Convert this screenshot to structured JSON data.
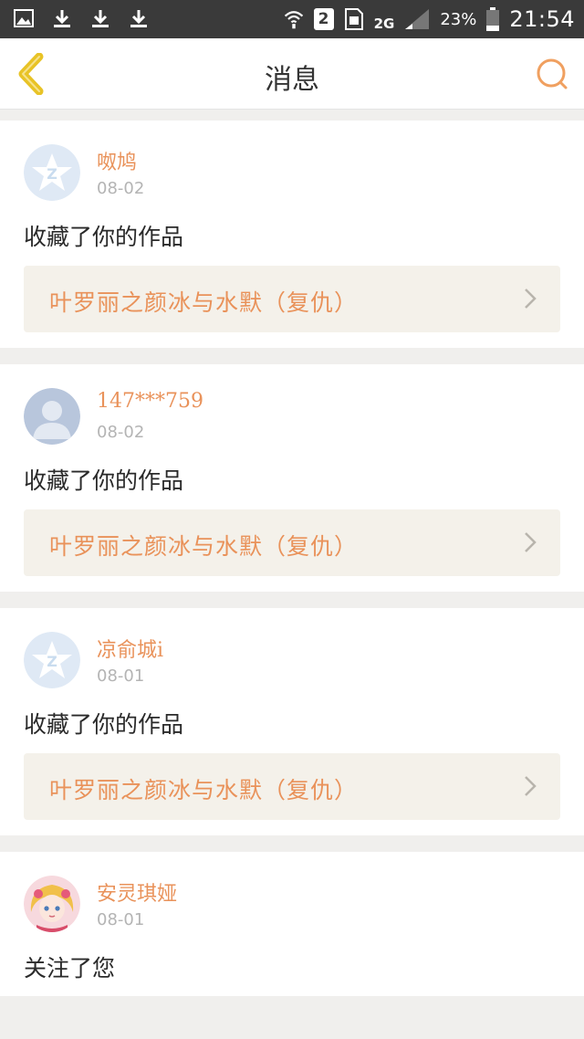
{
  "status_bar": {
    "signal_type": "2G",
    "battery": "23%",
    "time": "21:54",
    "sim": "2"
  },
  "header": {
    "title": "消息"
  },
  "colors": {
    "accent": "#e9925a",
    "back_icon": "#e8c326",
    "search_icon": "#f0a060"
  },
  "messages": [
    {
      "name": "呶鸠",
      "date": "08-02",
      "action": "收藏了你的作品",
      "work": "叶罗丽之颜冰与水默（复仇）",
      "avatar": "qq-star-avatar"
    },
    {
      "name": "147***759",
      "date": "08-02",
      "action": "收藏了你的作品",
      "work": "叶罗丽之颜冰与水默（复仇）",
      "avatar": "default-person-avatar"
    },
    {
      "name": "凉俞城i",
      "date": "08-01",
      "action": "收藏了你的作品",
      "work": "叶罗丽之颜冰与水默（复仇）",
      "avatar": "qq-star-avatar"
    },
    {
      "name": "安灵琪娅",
      "date": "08-01",
      "action": "关注了您",
      "avatar": "anime-girl-avatar"
    }
  ]
}
